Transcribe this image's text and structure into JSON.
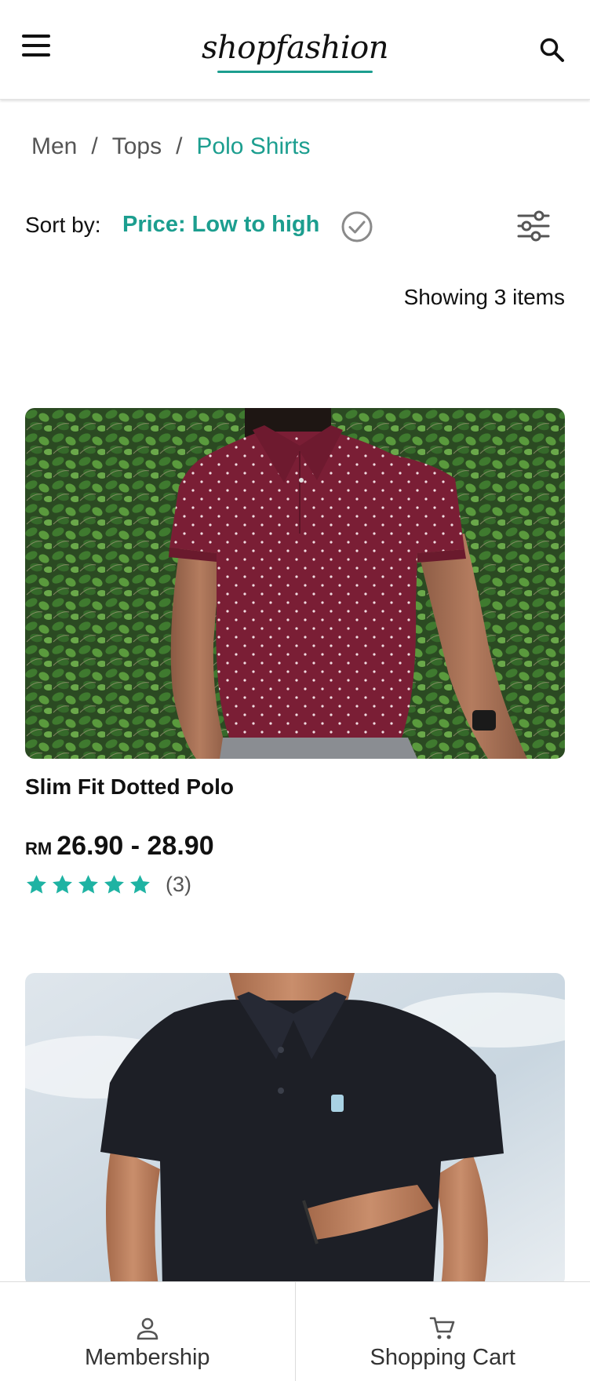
{
  "header": {
    "logo": "shopfashion",
    "menu_icon": "hamburger-menu-icon",
    "search_icon": "search-icon"
  },
  "breadcrumb": [
    "Men",
    "Tops",
    "Polo Shirts"
  ],
  "sort": {
    "label": "Sort by:",
    "value": "Price: Low to high",
    "check_icon": "check-circle-icon",
    "filter_icon": "filter-sliders-icon"
  },
  "result_count": "Showing 3 items",
  "products": [
    {
      "name": "Slim Fit Dotted Polo",
      "currency": "RM",
      "price": "26.90 - 28.90",
      "rating": 5,
      "review_count": "(3)",
      "image": "man in maroon dotted polo shirt against green ivy"
    },
    {
      "image": "man in black polo shirt against sky"
    }
  ],
  "bottom_nav": [
    {
      "label": "Membership",
      "icon": "person-icon"
    },
    {
      "label": "Shopping Cart",
      "icon": "cart-icon"
    }
  ],
  "colors": {
    "accent": "#1c9e8f",
    "star": "#1fb3a3",
    "text": "#111111",
    "muted": "#555555"
  }
}
